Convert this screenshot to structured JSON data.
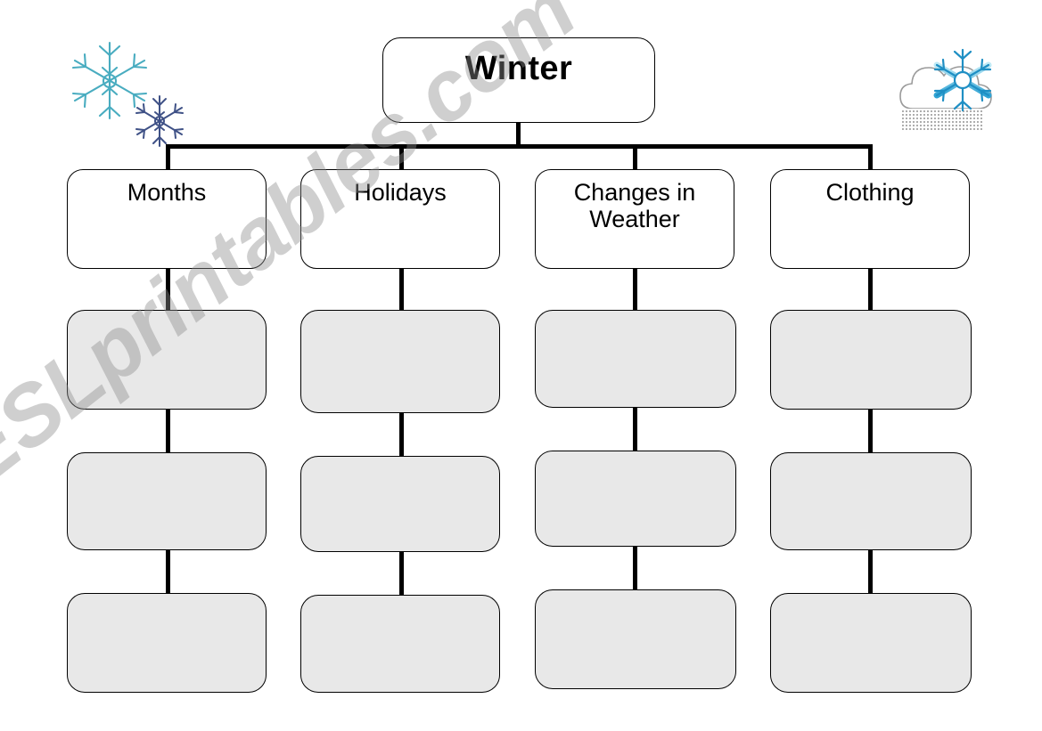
{
  "worksheet": {
    "title_box": {
      "label": "Winter"
    },
    "categories": [
      {
        "label": "Months"
      },
      {
        "label": "Holidays"
      },
      {
        "label": "Changes in\nWeather"
      },
      {
        "label": "Clothing"
      }
    ],
    "blank_rows": 3,
    "blank_cell_label": "",
    "decorations": [
      {
        "icon": "snowflake-icon",
        "color": "#2e9ab0"
      },
      {
        "icon": "snowflake-icon",
        "color": "#2b3f7a"
      },
      {
        "icon": "snow-cloud-icon",
        "color": "#29a8d8"
      }
    ]
  },
  "watermark": {
    "text": "ESLprintables.com"
  },
  "colors": {
    "blank_fill": "#e8e8e8",
    "line": "#000000",
    "page": "#ffffff",
    "snowflake_teal": "#2e9ab0",
    "snowflake_navy": "#2b3f7a",
    "snowflake_blue": "#29a8d8"
  }
}
